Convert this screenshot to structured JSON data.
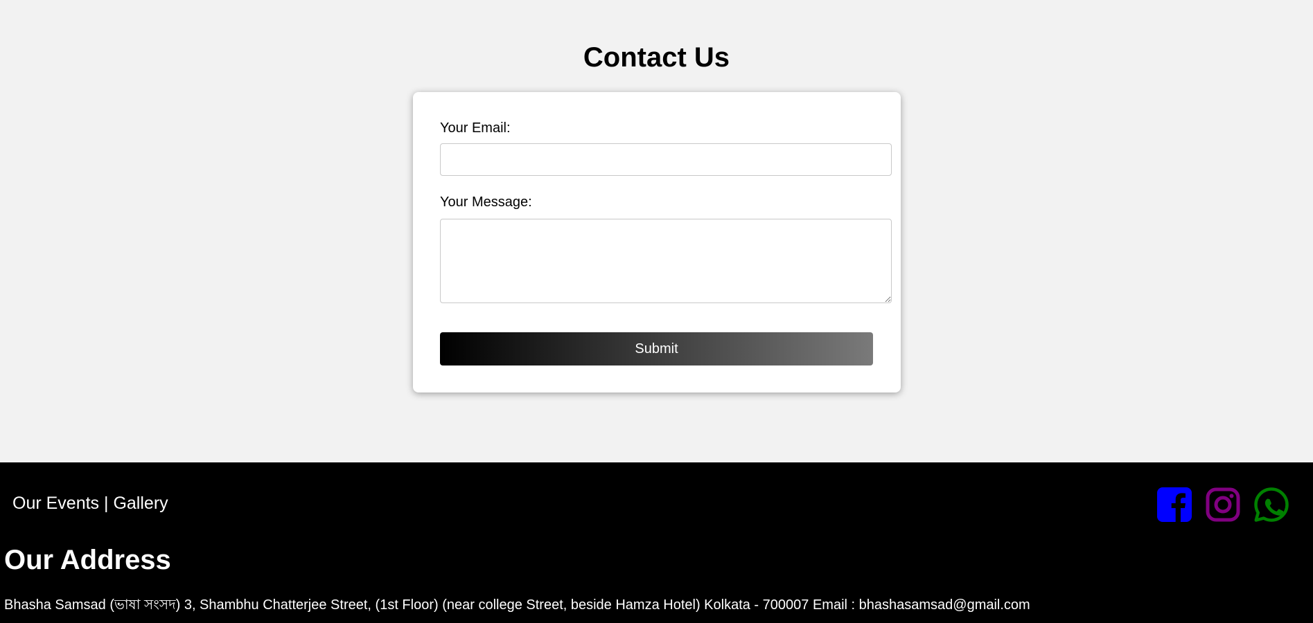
{
  "page": {
    "title": "Contact Us"
  },
  "form": {
    "email_label": "Your Email:",
    "email_value": "",
    "message_label": "Your Message:",
    "message_value": "",
    "submit_label": "Submit",
    "submit_gradient": [
      "#000000",
      "#7a7a7a"
    ]
  },
  "footer": {
    "links": [
      {
        "label": "Our Events"
      },
      {
        "label": "Gallery"
      }
    ],
    "separator": " | ",
    "social": [
      {
        "icon": "facebook-icon",
        "color": "#0000ff"
      },
      {
        "icon": "instagram-icon",
        "color": "#800080"
      },
      {
        "icon": "whatsapp-icon",
        "color": "#008000"
      }
    ],
    "address_title": "Our Address",
    "address_text": "Bhasha Samsad (ভাষা সংসদ) 3, Shambhu Chatterjee Street, (1st Floor) (near college Street, beside Hamza Hotel) Kolkata - 700007 Email : bhashasamsad@gmail.com"
  }
}
